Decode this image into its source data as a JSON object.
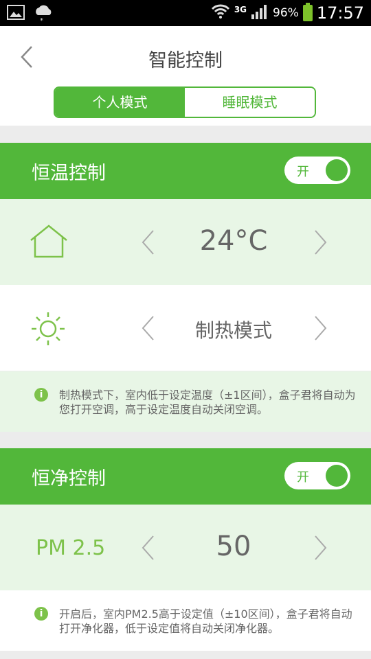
{
  "status_bar": {
    "network": "3G",
    "battery": "96%",
    "time": "17:57",
    "icons": [
      "image-icon",
      "weather-icon",
      "wifi-icon",
      "signal-icon",
      "battery-icon"
    ]
  },
  "header": {
    "title": "智能控制",
    "tabs": [
      {
        "label": "个人模式",
        "active": true
      },
      {
        "label": "睡眠模式",
        "active": false
      }
    ]
  },
  "thermostat": {
    "title": "恒温控制",
    "toggle_label": "开",
    "temperature": "24°C",
    "mode": "制热模式",
    "info": "制热模式下，室内低于设定温度（±1区间），盒子君将自动为您打开空调，高于设定温度自动关闭空调。"
  },
  "purifier": {
    "title": "恒净控制",
    "toggle_label": "开",
    "pm_label": "PM 2.5",
    "pm_value": "50",
    "info": "开启后，室内PM2.5高于设定值（±10区间），盒子君将自动打开净化器，低于设定值将自动关闭净化器。"
  },
  "colors": {
    "accent": "#52b73a",
    "light_bg": "#e8f6e6",
    "text": "#666666"
  }
}
